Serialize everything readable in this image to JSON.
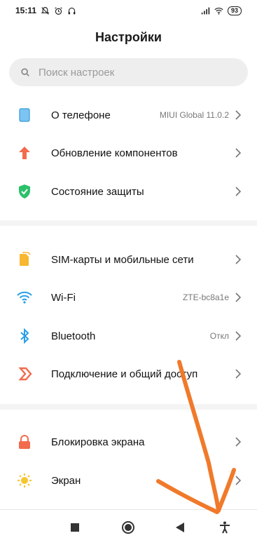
{
  "status_bar": {
    "time": "15:11",
    "battery": "93"
  },
  "header": {
    "title": "Настройки"
  },
  "search": {
    "placeholder": "Поиск настроек"
  },
  "items": [
    {
      "label": "О телефоне",
      "value": "MIUI Global 11.0.2"
    },
    {
      "label": "Обновление компонентов",
      "value": ""
    },
    {
      "label": "Состояние защиты",
      "value": ""
    },
    {
      "label": "SIM-карты и мобильные сети",
      "value": ""
    },
    {
      "label": "Wi-Fi",
      "value": "ZTE-bc8a1e"
    },
    {
      "label": "Bluetooth",
      "value": "Откл"
    },
    {
      "label": "Подключение и общий доступ",
      "value": ""
    },
    {
      "label": "Блокировка экрана",
      "value": ""
    },
    {
      "label": "Экран",
      "value": ""
    }
  ],
  "colors": {
    "phone": "#5ab0e8",
    "update": "#f26b4d",
    "security": "#2bc16a",
    "sim": "#f7b731",
    "wifi": "#2b9fe6",
    "bluetooth": "#2b9fe6",
    "sharing": "#f26b4d",
    "lock": "#f26b4d",
    "display": "#f7c531",
    "annotation_arrow": "#f07a2a"
  }
}
